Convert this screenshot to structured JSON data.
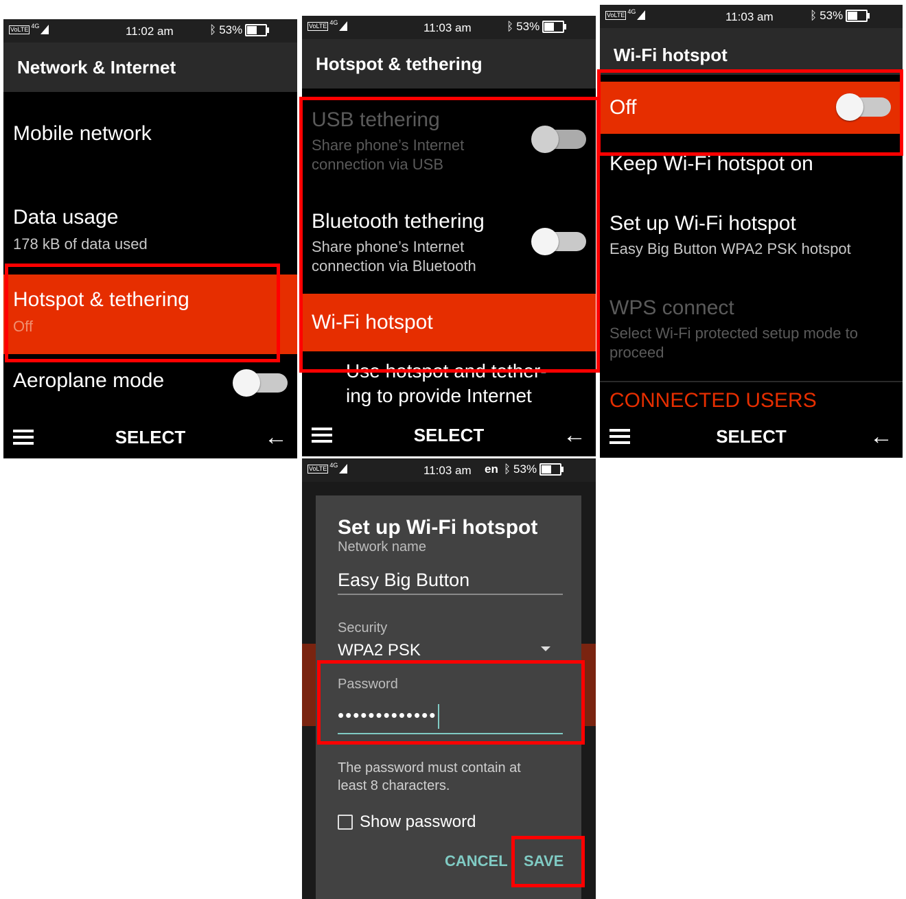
{
  "status": {
    "volte": "VoLTE",
    "network": "4G",
    "battery": "53%",
    "bt_icon": "ᛒ",
    "screen1_time": "11:02 am",
    "screen2_time": "11:03 am",
    "screen3_time": "11:03 am",
    "screen4_time": "11:03 am",
    "screen4_lang": "en"
  },
  "common": {
    "select": "SELECT",
    "back": "←"
  },
  "screen1": {
    "title": "Network & Internet",
    "items": [
      {
        "title": "Mobile network"
      },
      {
        "title": "Data usage",
        "sub": "178 kB of data used"
      },
      {
        "title": "Hotspot & tethering",
        "sub": "Off"
      },
      {
        "title": "Aeroplane mode"
      }
    ]
  },
  "screen2": {
    "title": "Hotspot & tethering",
    "items": [
      {
        "title": "USB tethering",
        "sub1": "Share phone’s Internet",
        "sub2": "connection via USB"
      },
      {
        "title": "Bluetooth tethering",
        "sub1": "Share phone’s Internet",
        "sub2": "connection via Bluetooth"
      },
      {
        "title": "Wi-Fi hotspot"
      }
    ],
    "footer1": "Use hotspot and tether-",
    "footer2": "ing to provide Internet"
  },
  "screen3": {
    "title": "Wi-Fi hotspot",
    "toggle_label": "Off",
    "items": [
      {
        "title": "Keep Wi-Fi hotspot on"
      },
      {
        "title": "Set up Wi-Fi hotspot",
        "sub": "Easy Big Button WPA2 PSK hotspot"
      },
      {
        "title": "WPS connect",
        "sub1": "Select Wi-Fi protected setup mode to",
        "sub2": "proceed"
      }
    ],
    "section": "CONNECTED USERS"
  },
  "screen4": {
    "dialog_title": "Set up Wi-Fi hotspot",
    "network_name_label": "Network name",
    "network_name_value": "Easy Big Button",
    "security_label": "Security",
    "security_value": "WPA2 PSK",
    "password_label": "Password",
    "password_value": "•••••••••••••",
    "hint1": "The password must contain at",
    "hint2": "least 8 characters.",
    "show_password": "Show password",
    "cancel": "CANCEL",
    "save": "SAVE"
  },
  "colors": {
    "accent": "#e62e00",
    "highlight_box": "#ff0000",
    "dialog_button": "#80cbc4"
  }
}
